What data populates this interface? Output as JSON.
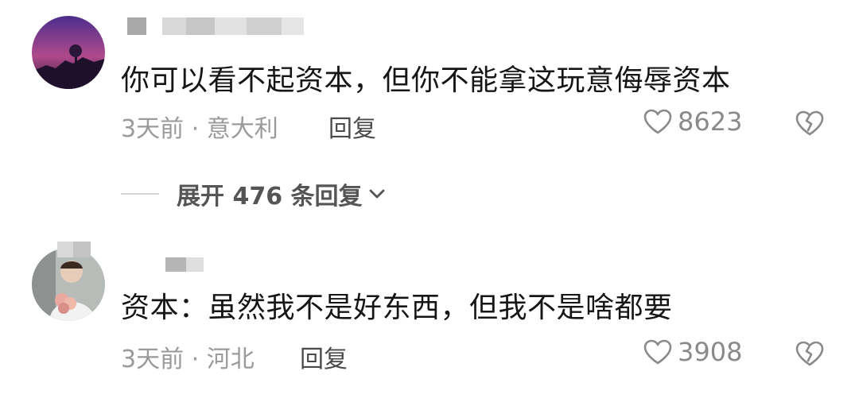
{
  "comments": [
    {
      "text": "你可以看不起资本，但你不能拿这玩意侮辱资本",
      "meta": "3天前 · 意大利",
      "reply_label": "回复",
      "likes": "8623",
      "avatar_icon": "user-avatar-sunset"
    },
    {
      "text": "资本：虽然我不是好东西，但我不是啥都要",
      "meta": "3天前 · 河北",
      "reply_label": "回复",
      "likes": "3908",
      "avatar_icon": "user-avatar-person"
    }
  ],
  "thread": {
    "expand_label": "展开 476 条回复"
  },
  "colors": {
    "text": "#161616",
    "meta": "#9a9a9a",
    "icon": "#8a8a8a"
  }
}
